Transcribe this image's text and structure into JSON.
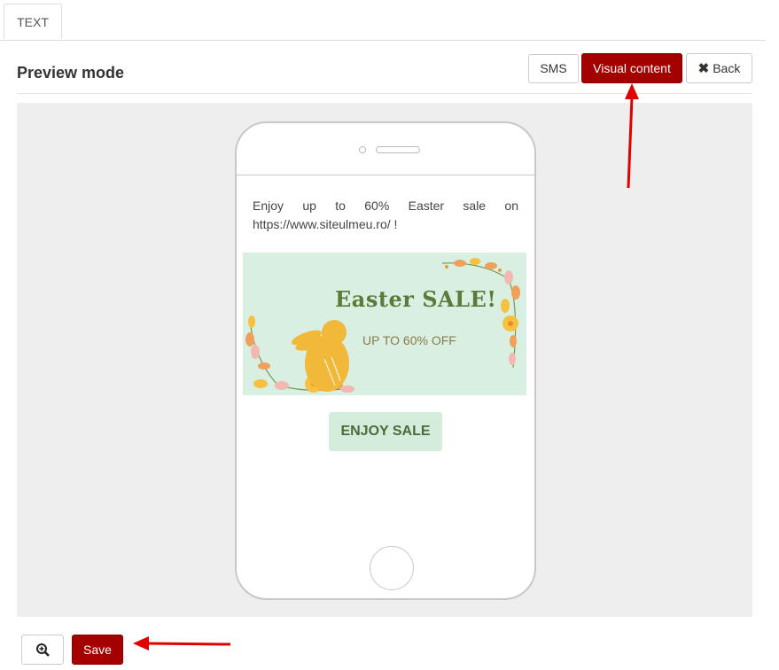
{
  "tabs": [
    {
      "label": "TEXT"
    }
  ],
  "header": {
    "title": "Preview mode"
  },
  "toolbar": {
    "sms_label": "SMS",
    "visual_label": "Visual content",
    "back_label": "Back",
    "back_icon": "close-icon"
  },
  "preview": {
    "message": "Enjoy up to 60% Easter sale on https://www.siteulmeu.ro/ !",
    "banner": {
      "headline": "Easter SALE!",
      "subline": "UP TO 60% OFF"
    },
    "cta_label": "ENJOY SALE"
  },
  "footer": {
    "zoom_icon": "zoom-in-icon",
    "save_label": "Save"
  },
  "colors": {
    "accent": "#a50000",
    "banner_bg": "#d8efe2",
    "arrow": "#e00000"
  }
}
